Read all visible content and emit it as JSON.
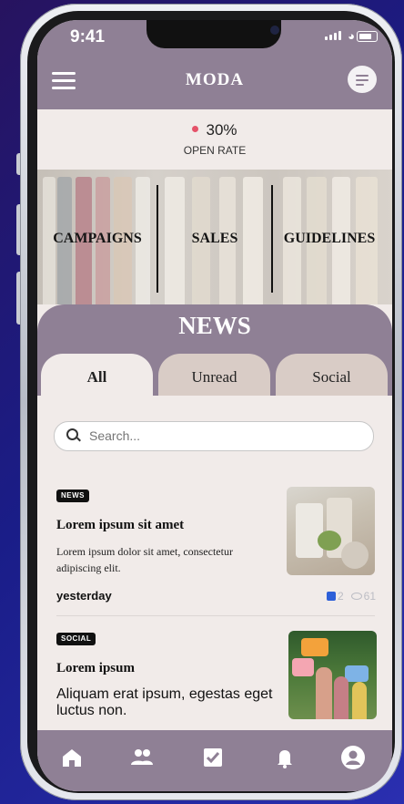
{
  "status": {
    "time": "9:41"
  },
  "app": {
    "title": "MODA"
  },
  "stats": {
    "open_rate_value": "30%",
    "open_rate_label": "OPEN RATE"
  },
  "categories": [
    "CAMPAIGNS",
    "SALES",
    "GUIDELINES"
  ],
  "news": {
    "heading": "NEWS",
    "tabs": [
      {
        "label": "All",
        "active": true
      },
      {
        "label": "Unread",
        "active": false
      },
      {
        "label": "Social",
        "active": false
      }
    ],
    "search_placeholder": "Search...",
    "items": [
      {
        "tag": "NEWS",
        "title": "Lorem ipsum sit amet",
        "body": "Lorem ipsum dolor sit amet, consectetur adipiscing elit.",
        "time": "yesterday",
        "likes": "2",
        "views": "61"
      },
      {
        "tag": "SOCIAL",
        "title": "Lorem ipsum",
        "body": "Aliquam erat ipsum, egestas eget luctus non."
      }
    ]
  },
  "bottom_nav": [
    "home-icon",
    "people-icon",
    "task-check-icon",
    "bell-icon",
    "profile-icon"
  ],
  "colors": {
    "primary": "#8f8095",
    "background": "#f1ebe9",
    "tab": "#d9ccc6",
    "accent_dot": "#e55269",
    "like": "#2d5fd8"
  }
}
